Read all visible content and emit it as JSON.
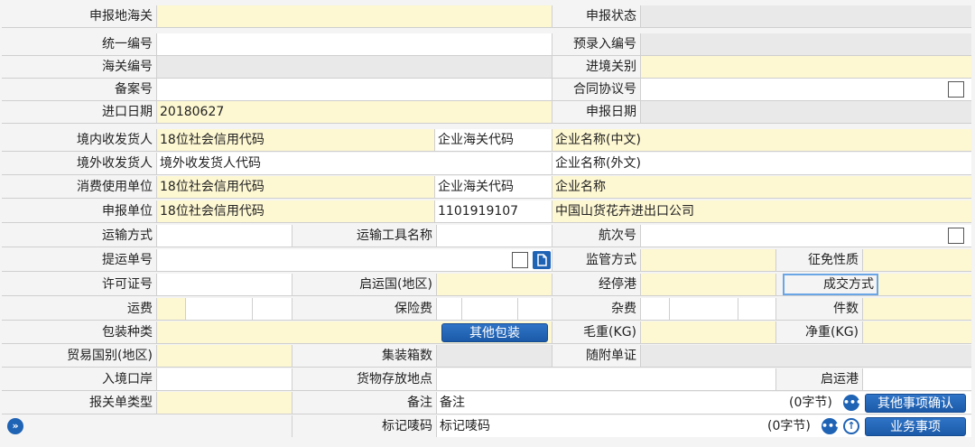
{
  "labels": {
    "declare_customs": "申报地海关",
    "declare_status": "申报状态",
    "unified_no": "统一编号",
    "pre_entry_no": "预录入编号",
    "customs_no": "海关编号",
    "ie_customs": "进境关别",
    "record_no": "备案号",
    "contract_no": "合同协议号",
    "import_date": "进口日期",
    "declare_date": "申报日期",
    "domestic_consignee": "境内收发货人",
    "enterprise_customs_code": "企业海关代码",
    "foreign_consignee": "境外收发货人",
    "consumer_unit": "消费使用单位",
    "declare_unit": "申报单位",
    "transport_mode": "运输方式",
    "transport_name": "运输工具名称",
    "voyage_no": "航次号",
    "bill_no": "提运单号",
    "supervision_mode": "监管方式",
    "levy_nature": "征免性质",
    "license_no": "许可证号",
    "departure_country": "启运国(地区)",
    "via_port": "经停港",
    "deal_mode": "成交方式",
    "freight": "运费",
    "insurance": "保险费",
    "misc_fee": "杂费",
    "pieces": "件数",
    "package_type": "包装种类",
    "gross_weight": "毛重(KG)",
    "net_weight": "净重(KG)",
    "trade_country": "贸易国别(地区)",
    "container_count": "集装箱数",
    "attached_docs": "随附单证",
    "entry_port": "入境口岸",
    "storage_place": "货物存放地点",
    "departure_port": "启运港",
    "declaration_type": "报关单类型",
    "remark": "备注",
    "marks": "标记唛码"
  },
  "values": {
    "import_date": "20180627",
    "domestic_consignee_code": "18位社会信用代码",
    "domestic_consignee_name": "企业名称(中文)",
    "foreign_consignee_code": "境外收发货人代码",
    "foreign_consignee_name": "企业名称(外文)",
    "consumer_unit_code": "18位社会信用代码",
    "consumer_unit_name": "企业名称",
    "declare_unit_code": "18位社会信用代码",
    "declare_unit_customs_code": "1101919107",
    "declare_unit_name": "中国山货花卉进出口公司",
    "remark": "备注",
    "marks": "标记唛码",
    "remark_count": "(0字节)",
    "marks_count": "(0字节)"
  },
  "buttons": {
    "other_package": "其他包装",
    "other_confirm": "其他事项确认",
    "business_items": "业务事项"
  },
  "icons": {
    "more": "more-icon",
    "upload": "upload-icon",
    "expand": "expand-icon",
    "file": "file-icon"
  }
}
